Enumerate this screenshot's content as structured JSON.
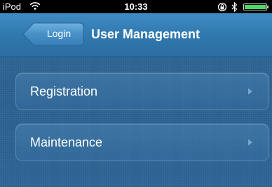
{
  "status_bar": {
    "carrier": "iPod",
    "time": "10:33",
    "wifi_icon": "wifi-icon",
    "rotation_lock_icon": "rotation-lock-icon",
    "bluetooth_icon": "bluetooth-icon",
    "battery_icon": "battery-icon",
    "battery_color": "#4cd964"
  },
  "nav_bar": {
    "back_label": "Login",
    "title": "User Management"
  },
  "menu": {
    "items": [
      {
        "label": "Registration",
        "icon": "chevron-right-icon"
      },
      {
        "label": "Maintenance",
        "icon": "chevron-right-icon"
      }
    ]
  },
  "colors": {
    "background": "#2a5f8c",
    "nav_bar": "#2f77ad",
    "status_bar": "#000000"
  }
}
